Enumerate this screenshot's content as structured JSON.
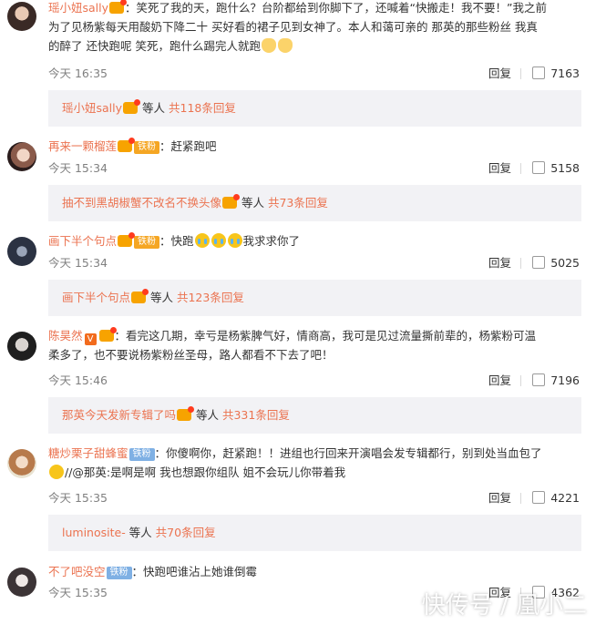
{
  "comments": [
    {
      "user": "瑶小妞sally",
      "text_lines": [
        "：笑死了我的天，跑什么？台阶都给到你脚下了，还喊着“快搬走！我不要！”我之前",
        "为了见杨紫每天用酸奶下降二十 买好看的裙子见到女神了。本人和蔼可亲的 那英的那些粉丝 我真",
        "的醉了 还快跑呢 笑死，跑什么踢完人就跑"
      ],
      "time": "今天 16:35",
      "reply": "回复",
      "likes": "7163",
      "sub": {
        "user": "瑶小妞sally",
        "mid": " 等人",
        "count": "共118条回复"
      }
    },
    {
      "user": "再来一颗榴莲",
      "fan": "铁粉",
      "text": "：赶紧跑吧",
      "time": "今天 15:34",
      "reply": "回复",
      "likes": "5158",
      "sub": {
        "user": "抽不到黑胡椒蟹不改名不换头像",
        "mid": " 等人",
        "count": "共73条回复"
      }
    },
    {
      "user": "画下半个句点",
      "fan": "铁粉",
      "text_a": "：快跑",
      "text_b": "我求求你了",
      "time": "今天 15:34",
      "reply": "回复",
      "likes": "5025",
      "sub": {
        "user": "画下半个句点",
        "mid": " 等人",
        "count": "共123条回复"
      }
    },
    {
      "user": "陈昊然",
      "text_lines": [
        "：看完这几期，幸亏是杨紫脾气好，情商高，我可是见过流量撕前辈的，杨紫粉可温",
        "柔多了，也不要说杨紫粉丝圣母，路人都看不下去了吧！"
      ],
      "time": "今天 15:46",
      "reply": "回复",
      "likes": "7196",
      "sub": {
        "user": "那英今天发新专辑了吗",
        "mid": " 等人",
        "count": "共331条回复"
      }
    },
    {
      "user": "糖炒栗子甜蜂蜜",
      "fan": "铁粉",
      "text_lines": [
        "：你傻啊你，赶紧跑！！进组也行回来开演唱会发专辑都行，别到处当血包了",
        "//@那英:是啊是啊 我也想跟你组队 姐不会玩儿你带着我"
      ],
      "time": "今天 15:35",
      "reply": "回复",
      "likes": "4221",
      "sub": {
        "user": "luminosite-",
        "mid": " 等人",
        "count": "共70条回复"
      }
    },
    {
      "user": "不了吧没空",
      "fan": "铁粉",
      "text": "：快跑吧谁沾上她谁倒霉",
      "time": "今天 15:35",
      "reply": "回复",
      "likes": "4362"
    }
  ],
  "watermark": "快传号 / 凰小二"
}
